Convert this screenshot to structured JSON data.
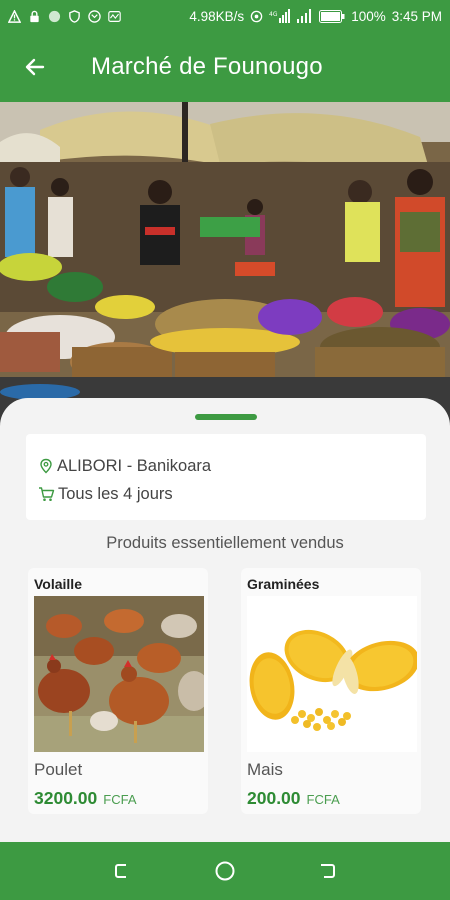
{
  "status_bar": {
    "speed": "4.98KB/s",
    "battery": "100%",
    "time": "3:45 PM"
  },
  "app_bar": {
    "title": "Marché de Founougo"
  },
  "info": {
    "location": "ALIBORI - Banikoara",
    "frequency": "Tous les 4 jours"
  },
  "section_title": "Produits essentiellement vendus",
  "products": [
    {
      "category": "Volaille",
      "name": "Poulet",
      "price": "3200.00",
      "currency": "FCFA"
    },
    {
      "category": "Graminées",
      "name": "Mais",
      "price": "200.00",
      "currency": "FCFA"
    }
  ],
  "colors": {
    "primary": "#3d9a42",
    "price": "#2e8b34"
  }
}
